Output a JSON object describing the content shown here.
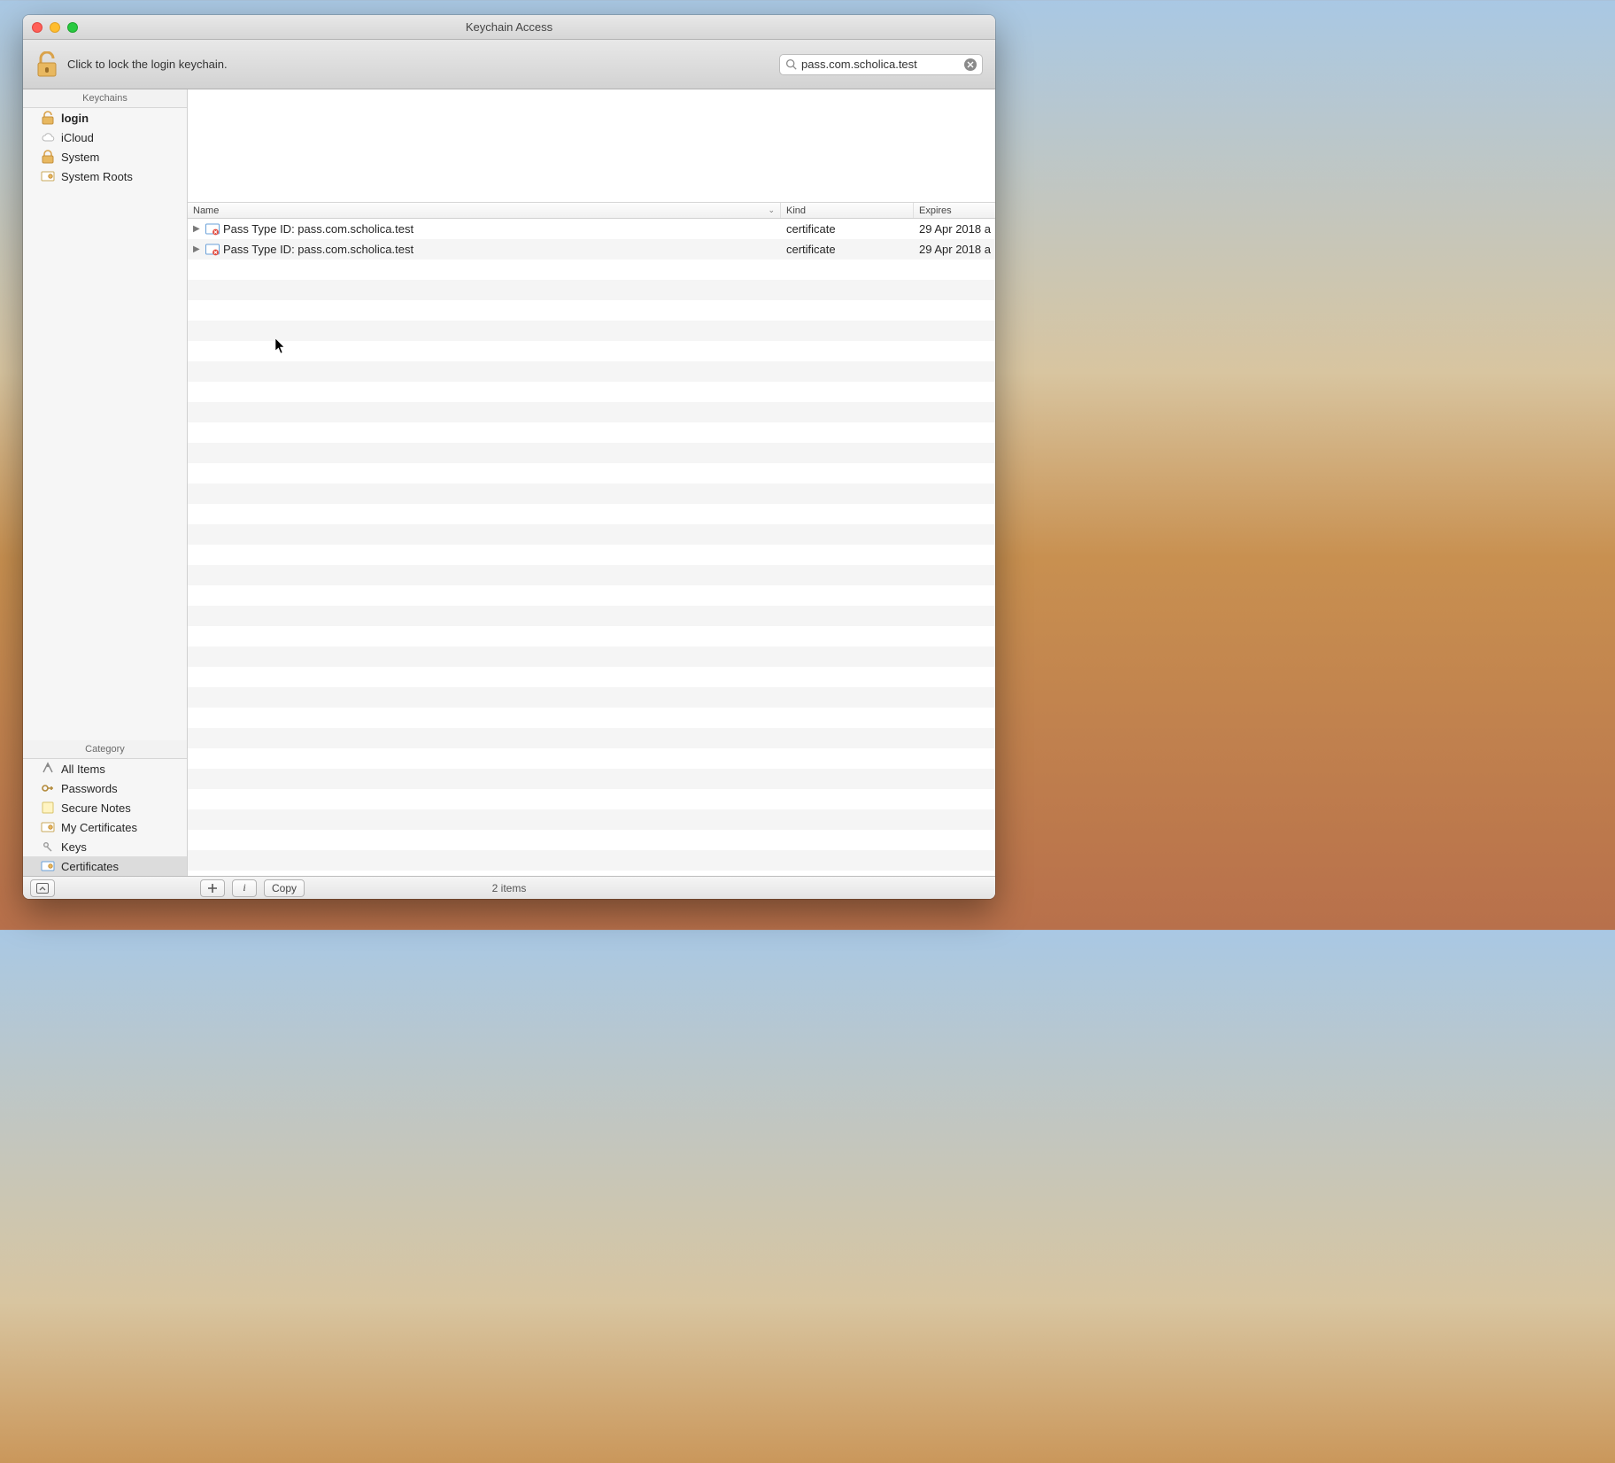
{
  "window": {
    "title": "Keychain Access"
  },
  "toolbar": {
    "lock_hint": "Click to lock the login keychain.",
    "search_value": "pass.com.scholica.test"
  },
  "sidebar": {
    "keychains_header": "Keychains",
    "category_header": "Category",
    "keychains": [
      {
        "label": "login",
        "icon": "lock-open",
        "selected": true
      },
      {
        "label": "iCloud",
        "icon": "cloud",
        "selected": false
      },
      {
        "label": "System",
        "icon": "lock",
        "selected": false
      },
      {
        "label": "System Roots",
        "icon": "cert",
        "selected": false
      }
    ],
    "categories": [
      {
        "label": "All Items",
        "icon": "scissors",
        "selected": false
      },
      {
        "label": "Passwords",
        "icon": "key",
        "selected": false
      },
      {
        "label": "Secure Notes",
        "icon": "note",
        "selected": false
      },
      {
        "label": "My Certificates",
        "icon": "cert",
        "selected": false
      },
      {
        "label": "Keys",
        "icon": "keys",
        "selected": false
      },
      {
        "label": "Certificates",
        "icon": "cert",
        "selected": true
      }
    ]
  },
  "columns": {
    "name": "Name",
    "kind": "Kind",
    "expires": "Expires"
  },
  "rows": [
    {
      "name": "Pass Type ID: pass.com.scholica.test",
      "kind": "certificate",
      "expires": "29 Apr 2018 a"
    },
    {
      "name": "Pass Type ID: pass.com.scholica.test",
      "kind": "certificate",
      "expires": "29 Apr 2018 a"
    }
  ],
  "bottom": {
    "copy_label": "Copy",
    "status": "2 items"
  }
}
